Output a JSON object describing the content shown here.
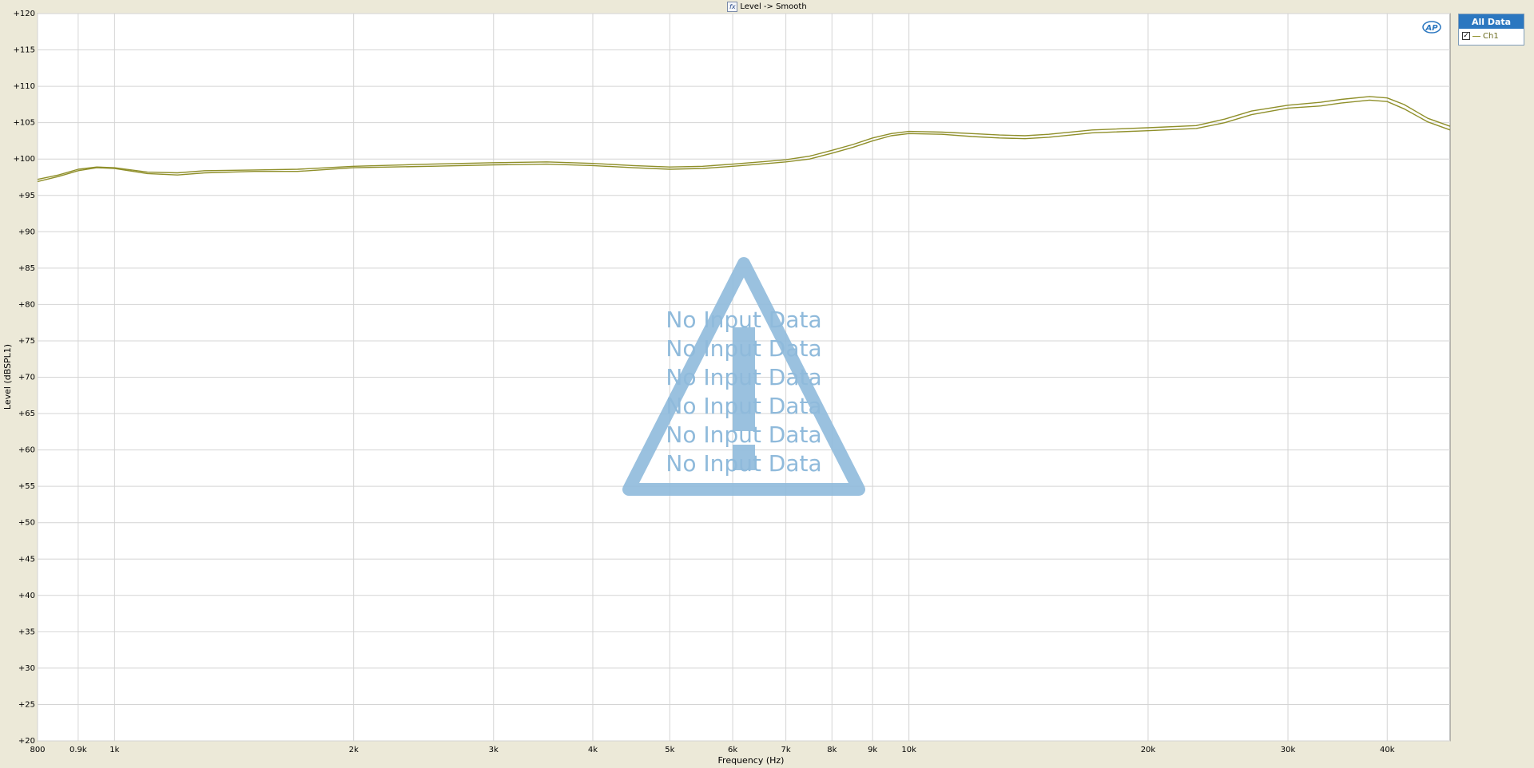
{
  "window": {
    "title": "Level -> Smooth",
    "fx_icon": "fx-icon"
  },
  "legend": {
    "header": "All Data",
    "items": [
      {
        "label": "Ch1",
        "checked": true,
        "color": "#8f8f2a"
      }
    ]
  },
  "overlay": {
    "icon": "warning-triangle-icon",
    "color": "#8fbadb",
    "lines": [
      "No Input Data",
      "No Input Data",
      "No Input Data",
      "No Input Data",
      "No Input Data",
      "No Input Data"
    ]
  },
  "logo": {
    "text": "AP",
    "icon": "ap-logo-icon",
    "color": "#2b77c0"
  },
  "chart_data": {
    "type": "line",
    "xlabel": "Frequency (Hz)",
    "ylabel": "Level (dBSPL1)",
    "xscale": "log",
    "xlim": [
      800,
      48000
    ],
    "ylim": [
      20,
      120
    ],
    "x_ticks": [
      {
        "value": 800,
        "label": "800"
      },
      {
        "value": 900,
        "label": "0.9k"
      },
      {
        "value": 1000,
        "label": "1k"
      },
      {
        "value": 2000,
        "label": "2k"
      },
      {
        "value": 3000,
        "label": "3k"
      },
      {
        "value": 4000,
        "label": "4k"
      },
      {
        "value": 5000,
        "label": "5k"
      },
      {
        "value": 6000,
        "label": "6k"
      },
      {
        "value": 7000,
        "label": "7k"
      },
      {
        "value": 8000,
        "label": "8k"
      },
      {
        "value": 9000,
        "label": "9k"
      },
      {
        "value": 10000,
        "label": "10k"
      },
      {
        "value": 20000,
        "label": "20k"
      },
      {
        "value": 30000,
        "label": "30k"
      },
      {
        "value": 40000,
        "label": "40k"
      }
    ],
    "y_ticks": [
      {
        "value": 120,
        "label": "+120"
      },
      {
        "value": 115,
        "label": "+115"
      },
      {
        "value": 110,
        "label": "+110"
      },
      {
        "value": 105,
        "label": "+105"
      },
      {
        "value": 100,
        "label": "+100"
      },
      {
        "value": 95,
        "label": "+95"
      },
      {
        "value": 90,
        "label": "+90"
      },
      {
        "value": 85,
        "label": "+85"
      },
      {
        "value": 80,
        "label": "+80"
      },
      {
        "value": 75,
        "label": "+75"
      },
      {
        "value": 70,
        "label": "+70"
      },
      {
        "value": 65,
        "label": "+65"
      },
      {
        "value": 60,
        "label": "+60"
      },
      {
        "value": 55,
        "label": "+55"
      },
      {
        "value": 50,
        "label": "+50"
      },
      {
        "value": 45,
        "label": "+45"
      },
      {
        "value": 40,
        "label": "+40"
      },
      {
        "value": 35,
        "label": "+35"
      },
      {
        "value": 30,
        "label": "+30"
      },
      {
        "value": 25,
        "label": "+25"
      },
      {
        "value": 20,
        "label": "+20"
      }
    ],
    "grid": true,
    "legend_position": "right",
    "series": [
      {
        "name": "Ch1",
        "color": "#8f8f2a",
        "x": [
          800,
          850,
          900,
          950,
          1000,
          1100,
          1200,
          1300,
          1500,
          1700,
          2000,
          2500,
          3000,
          3500,
          4000,
          4500,
          5000,
          5500,
          6000,
          6500,
          7000,
          7500,
          8000,
          8500,
          9000,
          9500,
          10000,
          11000,
          12000,
          13000,
          14000,
          15000,
          17000,
          20000,
          23000,
          25000,
          27000,
          30000,
          33000,
          35000,
          38000,
          40000,
          42000,
          45000,
          48000
        ],
        "y": [
          97.2,
          97.8,
          98.6,
          98.9,
          98.8,
          98.2,
          98.1,
          98.4,
          98.5,
          98.6,
          99.0,
          99.3,
          99.5,
          99.6,
          99.4,
          99.1,
          98.9,
          99.0,
          99.3,
          99.6,
          99.9,
          100.4,
          101.2,
          102.0,
          102.9,
          103.5,
          103.8,
          103.7,
          103.5,
          103.3,
          103.2,
          103.4,
          104.0,
          104.3,
          104.6,
          105.5,
          106.6,
          107.4,
          107.8,
          108.2,
          108.6,
          108.4,
          107.5,
          105.6,
          104.5
        ]
      },
      {
        "name": "Ch1",
        "color": "#8f8f2a",
        "x": [
          800,
          850,
          900,
          950,
          1000,
          1100,
          1200,
          1300,
          1500,
          1700,
          2000,
          2500,
          3000,
          3500,
          4000,
          4500,
          5000,
          5500,
          6000,
          6500,
          7000,
          7500,
          8000,
          8500,
          9000,
          9500,
          10000,
          11000,
          12000,
          13000,
          14000,
          15000,
          17000,
          20000,
          23000,
          25000,
          27000,
          30000,
          33000,
          35000,
          38000,
          40000,
          42000,
          45000,
          48000
        ],
        "y": [
          96.9,
          97.6,
          98.4,
          98.8,
          98.7,
          98.0,
          97.8,
          98.1,
          98.3,
          98.3,
          98.8,
          99.0,
          99.2,
          99.3,
          99.1,
          98.8,
          98.6,
          98.7,
          99.0,
          99.3,
          99.6,
          100.0,
          100.8,
          101.6,
          102.5,
          103.2,
          103.5,
          103.4,
          103.1,
          102.9,
          102.8,
          103.0,
          103.6,
          103.9,
          104.2,
          105.0,
          106.1,
          107.0,
          107.3,
          107.7,
          108.1,
          107.9,
          106.9,
          105.1,
          104.0
        ]
      }
    ]
  }
}
